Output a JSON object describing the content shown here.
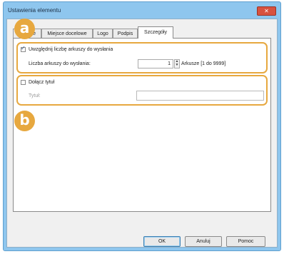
{
  "dialog": {
    "title": "Ustawienia elementu",
    "close_label": "✕"
  },
  "tabs": [
    "Ogólnie",
    "Miejsce docelowe",
    "Logo",
    "Podpis",
    "Szczegóły"
  ],
  "active_tab": "Szczegóły",
  "section_a": {
    "badge": "a",
    "checkbox_label": "Uwzględnij liczbę arkuszy do wysłania",
    "checked": true,
    "count_label": "Liczba arkuszy do wysłania:",
    "count_value": "1",
    "count_suffix": "Arkusze [1 do 9999]"
  },
  "section_b": {
    "badge": "b",
    "checkbox_label": "Dołącz tytuł",
    "checked": false,
    "title_label": "Tytuł:",
    "title_value": ""
  },
  "buttons": {
    "ok": "OK",
    "cancel": "Anuluj",
    "help": "Pomoc"
  },
  "colors": {
    "accent": "#e7a83f",
    "window_frame": "#8ec6ee"
  }
}
